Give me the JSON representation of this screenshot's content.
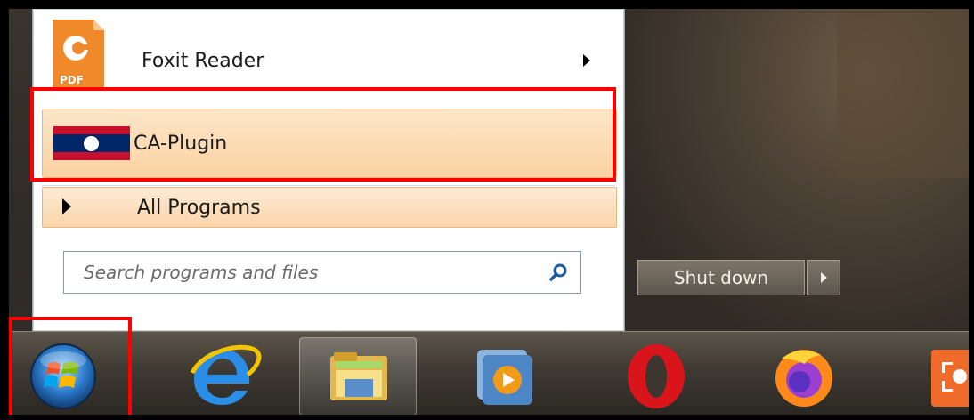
{
  "start_menu": {
    "pinned": [
      {
        "label": "Foxit Reader",
        "icon": "foxit-reader-icon",
        "has_submenu": true
      },
      {
        "label": "CA-Plugin",
        "icon": "laos-flag-icon",
        "highlighted": true
      }
    ],
    "all_programs_label": "All Programs",
    "search": {
      "placeholder": "Search programs and files"
    },
    "shutdown_label": "Shut down"
  },
  "taskbar": {
    "items": [
      "start-orb",
      "internet-explorer-icon",
      "file-explorer-icon",
      "media-player-icon",
      "opera-icon",
      "firefox-icon",
      "snipping-tool-icon"
    ]
  },
  "colors": {
    "highlight": "#ff0000",
    "menu_hover": "#fbd2a2"
  }
}
